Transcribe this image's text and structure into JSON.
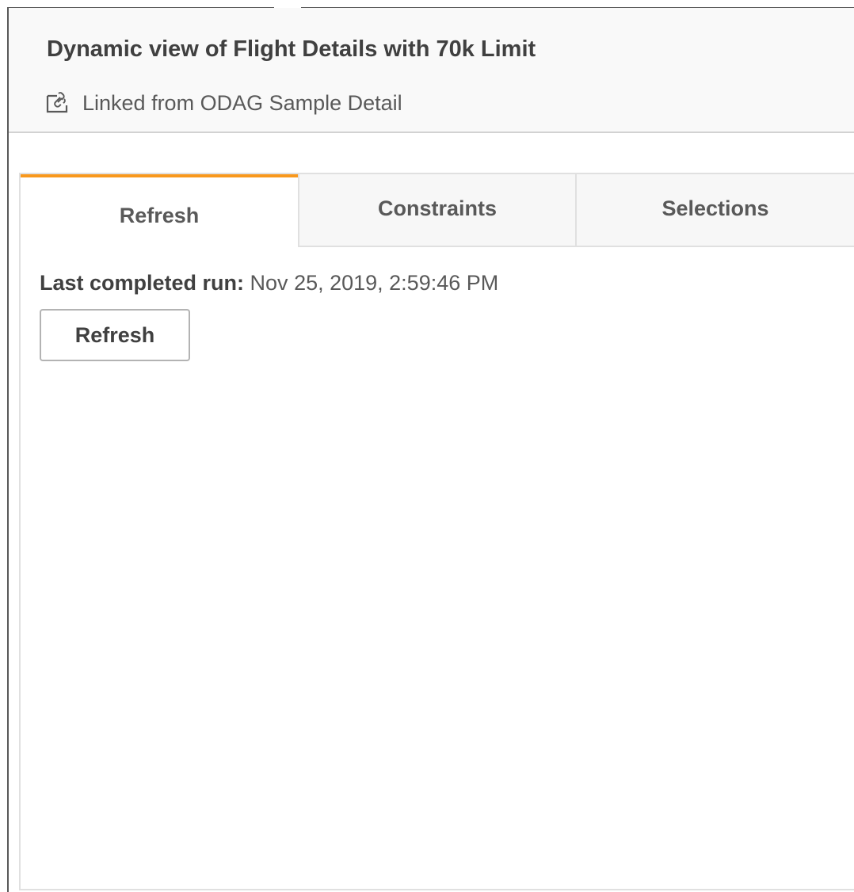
{
  "header": {
    "title": "Dynamic view of Flight Details with 70k Limit",
    "linked_text": "Linked from ODAG Sample Detail",
    "link_icon": "linked-app-icon"
  },
  "tabs": [
    {
      "label": "Refresh",
      "active": true
    },
    {
      "label": "Constraints",
      "active": false
    },
    {
      "label": "Selections",
      "active": false
    }
  ],
  "refresh_panel": {
    "last_run_label": "Last completed run:",
    "last_run_value": "Nov 25, 2019, 2:59:46 PM",
    "refresh_button_label": "Refresh"
  },
  "colors": {
    "active_tab_accent": "#f8981d",
    "text": "#404040",
    "header_bg": "#f9f9f9"
  }
}
